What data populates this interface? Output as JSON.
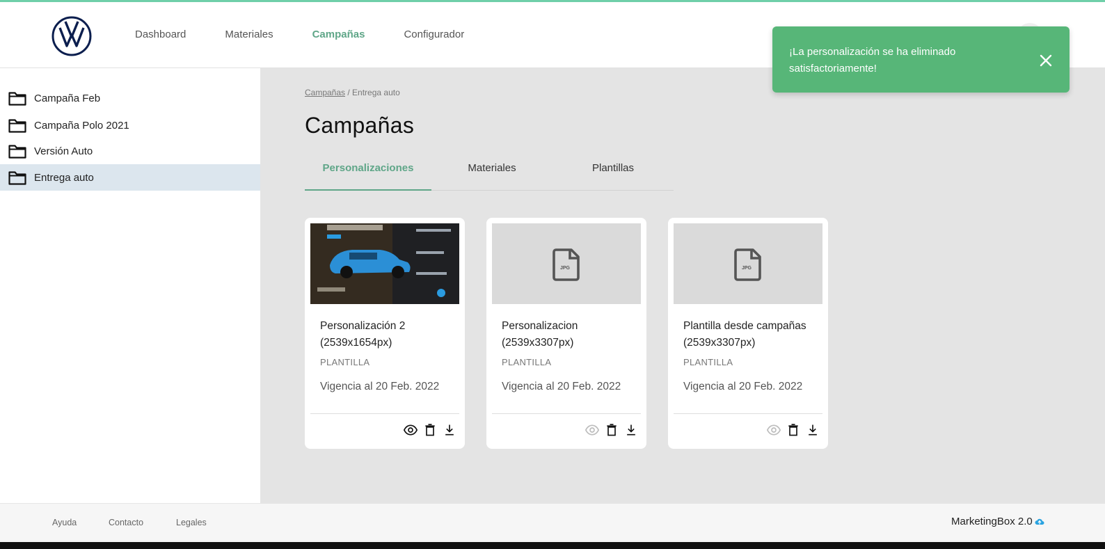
{
  "app": {
    "name": "MarketingBox 2.0",
    "brand_color": "#5fa688",
    "topline_color": "#6fcfa9",
    "logo": "vw-logo"
  },
  "nav": {
    "items": [
      {
        "label": "Dashboard",
        "active": false
      },
      {
        "label": "Materiales",
        "active": false
      },
      {
        "label": "Campañas",
        "active": true
      },
      {
        "label": "Configurador",
        "active": false
      }
    ]
  },
  "sidebar": {
    "items": [
      {
        "label": "Campaña Feb",
        "icon": "folder-icon",
        "active": false
      },
      {
        "label": "Campaña Polo 2021",
        "icon": "folder-icon",
        "active": false
      },
      {
        "label": "Versión Auto",
        "icon": "folder-icon",
        "active": false
      },
      {
        "label": "Entrega auto",
        "icon": "folder-icon",
        "active": true
      }
    ]
  },
  "breadcrumb": {
    "root": "Campañas",
    "separator": " / ",
    "current": "Entrega auto"
  },
  "page": {
    "title": "Campañas"
  },
  "tabs": [
    {
      "label": "Personalizaciones",
      "active": true
    },
    {
      "label": "Materiales",
      "active": false
    },
    {
      "label": "Plantillas",
      "active": false
    }
  ],
  "cards": [
    {
      "title": "Personalización 2 (2539x1654px)",
      "type": "PLANTILLA",
      "validity": "Vigencia al 20 Feb. 2022",
      "thumbnail": "photo",
      "preview_enabled": true,
      "icons": [
        "eye-icon",
        "trash-icon",
        "download-icon"
      ]
    },
    {
      "title": "Personalizacion (2539x3307px)",
      "type": "PLANTILLA",
      "validity": "Vigencia al 20 Feb. 2022",
      "thumbnail": "jpg-file-icon",
      "thumbnail_label": "JPG",
      "preview_enabled": false,
      "icons": [
        "eye-icon",
        "trash-icon",
        "download-icon"
      ]
    },
    {
      "title": "Plantilla desde campañas (2539x3307px)",
      "type": "PLANTILLA",
      "validity": "Vigencia al 20 Feb. 2022",
      "thumbnail": "jpg-file-icon",
      "thumbnail_label": "JPG",
      "preview_enabled": false,
      "icons": [
        "eye-icon",
        "trash-icon",
        "download-icon"
      ]
    }
  ],
  "toast": {
    "message": "¡La personalización se ha eliminado satisfactoriamente!",
    "color": "#57b678",
    "icon": "close-icon"
  },
  "footer": {
    "links": [
      "Ayuda",
      "Contacto",
      "Legales"
    ],
    "brand": "MarketingBox 2.0",
    "brand_icon": "cloud-icon"
  }
}
